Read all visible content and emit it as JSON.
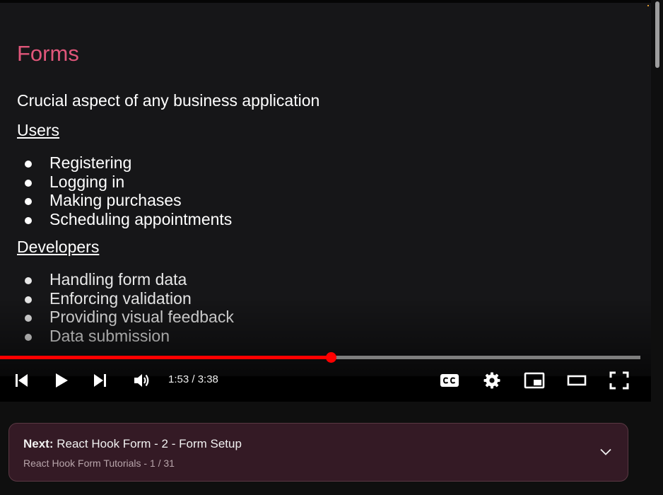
{
  "slide": {
    "title": "Forms",
    "subtitle": "Crucial aspect of any business application",
    "users_heading": "Users",
    "users_items": [
      "Registering",
      "Logging in",
      "Making purchases",
      "Scheduling appointments"
    ],
    "developers_heading": "Developers",
    "developers_items": [
      "Handling form data",
      "Enforcing validation",
      "Providing visual feedback",
      "Data submission"
    ],
    "title_color": "#e0567a"
  },
  "player": {
    "current_time": "1:53",
    "duration": "3:38",
    "time_display": "1:53 / 3:38",
    "progress_fraction": 0.518,
    "progress_color": "#ff0000",
    "icons": [
      "previous-icon",
      "play-icon",
      "next-icon",
      "volume-icon",
      "captions-icon",
      "settings-icon",
      "miniplayer-icon",
      "theater-mode-icon",
      "fullscreen-icon"
    ]
  },
  "next_card": {
    "prefix": "Next:",
    "title": "React Hook Form - 2 - Form Setup",
    "playlist_info": "React Hook Form Tutorials - 1 / 31",
    "background_color": "#341a25"
  }
}
